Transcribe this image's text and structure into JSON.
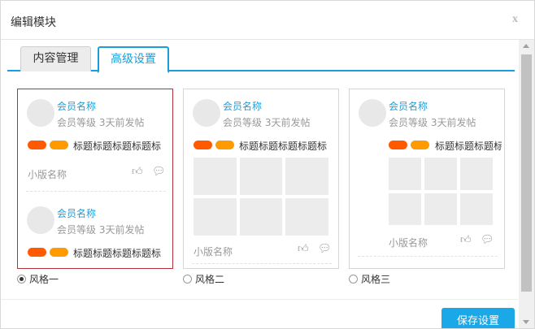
{
  "dialog": {
    "title": "编辑模块",
    "close_label": "x"
  },
  "tabs": [
    {
      "label": "内容管理",
      "active": false
    },
    {
      "label": "高级设置",
      "active": true
    }
  ],
  "post": {
    "member_name": "会员名称",
    "member_level": "会员等级",
    "post_time": "3天前发帖",
    "title_full": "标题标题标题标题标",
    "title_short": "标题标题标题标题",
    "forum_name": "小版名称"
  },
  "styles": [
    {
      "label": "风格一",
      "selected": true
    },
    {
      "label": "风格二",
      "selected": false
    },
    {
      "label": "风格三",
      "selected": false
    }
  ],
  "footer": {
    "save_label": "保存设置"
  },
  "colors": {
    "accent": "#1a9fdb",
    "tag_red": "#ff5a00",
    "tag_orange": "#ff9a00",
    "selected_border": "#b5303a"
  }
}
